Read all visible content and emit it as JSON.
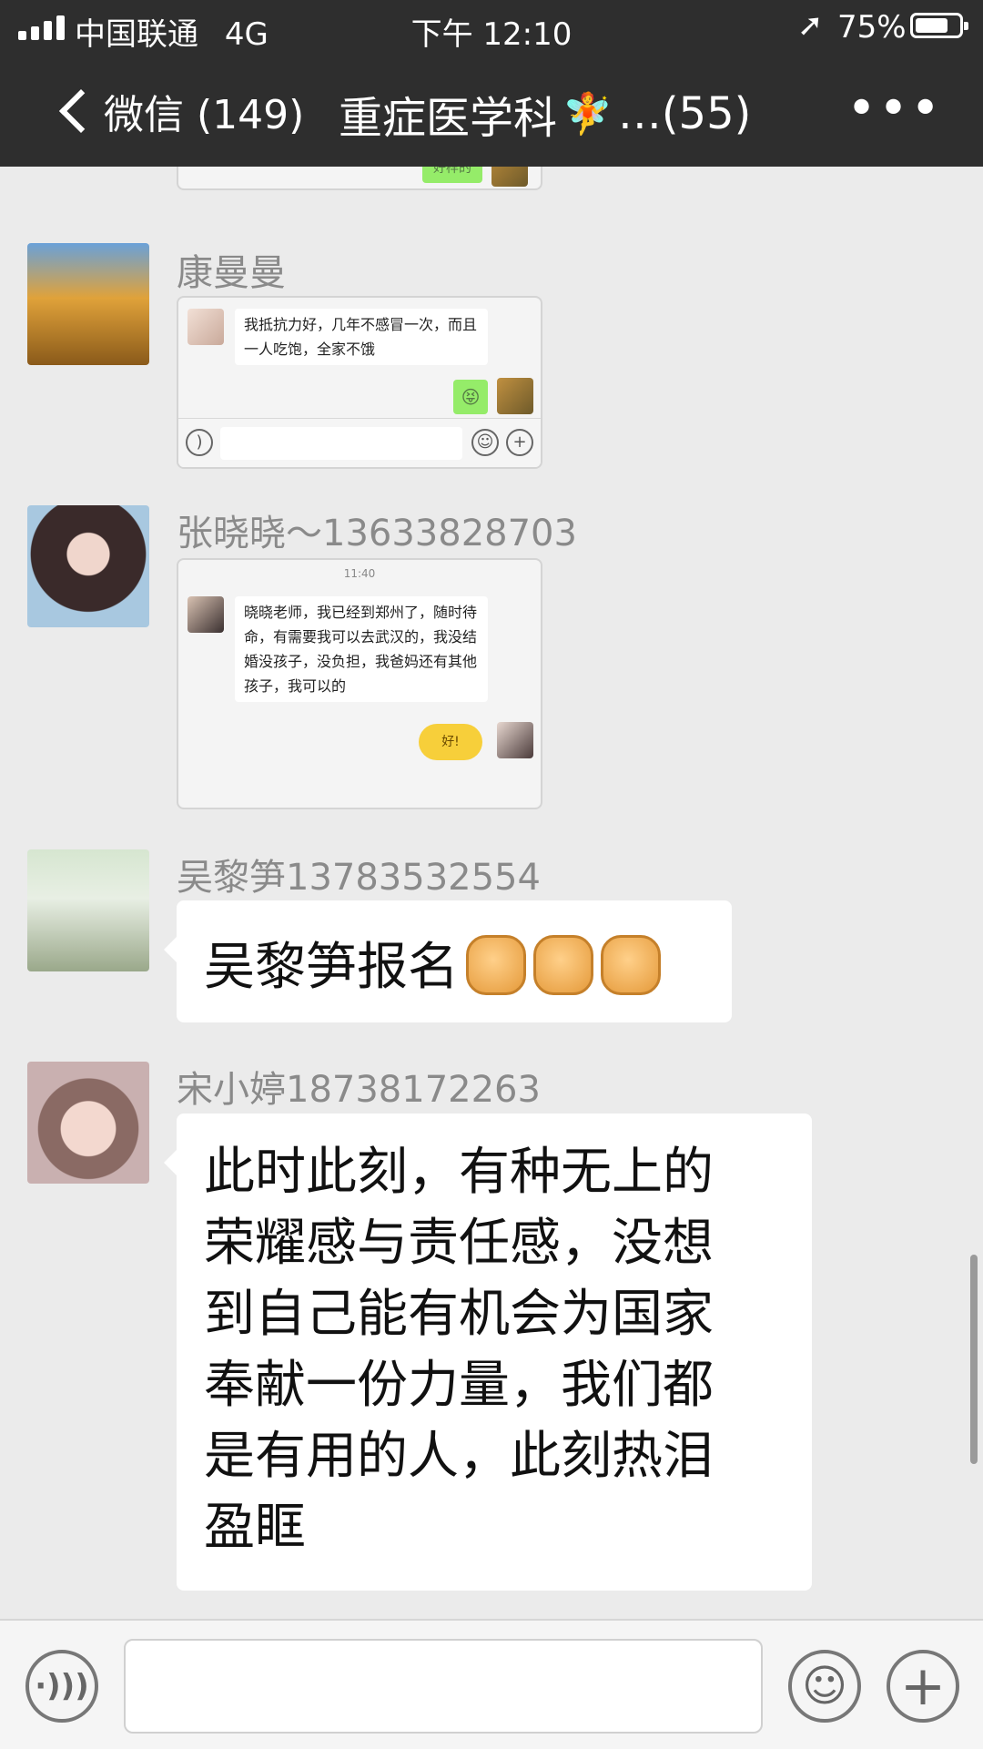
{
  "status_bar": {
    "carrier": "中国联通",
    "network": "4G",
    "time": "下午 12:10",
    "battery": "75%",
    "battery_level": 0.75
  },
  "nav": {
    "back_label": "微信 (149)",
    "title": "重症医学科",
    "title_suffix": "…(55)",
    "more": "•••"
  },
  "messages": [
    {
      "sender": "",
      "type": "screenshot",
      "inner": {
        "green_reply": "好样的"
      }
    },
    {
      "sender": "康曼曼",
      "type": "screenshot",
      "inner": {
        "text": "我抵抗力好，几年不感冒一次，而且一人吃饱，全家不饿",
        "reply_emoji": "😝"
      }
    },
    {
      "sender": "张晓晓～13633828703",
      "type": "screenshot",
      "inner": {
        "time": "11:40",
        "text": "晓晓老师，我已经到郑州了，随时待命，有需要我可以去武汉的，我没结婚没孩子，没负担，我爸妈还有其他孩子，我可以的",
        "sticker": "好!"
      }
    },
    {
      "sender": "吴黎笋13783532554",
      "type": "text",
      "text": "吴黎笋报名",
      "emoji_count": 3
    },
    {
      "sender": "宋小婷18738172263",
      "type": "text",
      "lines": [
        "此时此刻，有种无上的",
        "荣耀感与责任感，没想",
        "到自己能有机会为国家",
        "奉献一份力量，我们都",
        "是有用的人，此刻热泪",
        "盈眶"
      ]
    }
  ],
  "input_bar": {
    "voice_icon": "voice-icon",
    "emoji_icon": "emoji-icon",
    "plus_icon": "plus-icon"
  }
}
